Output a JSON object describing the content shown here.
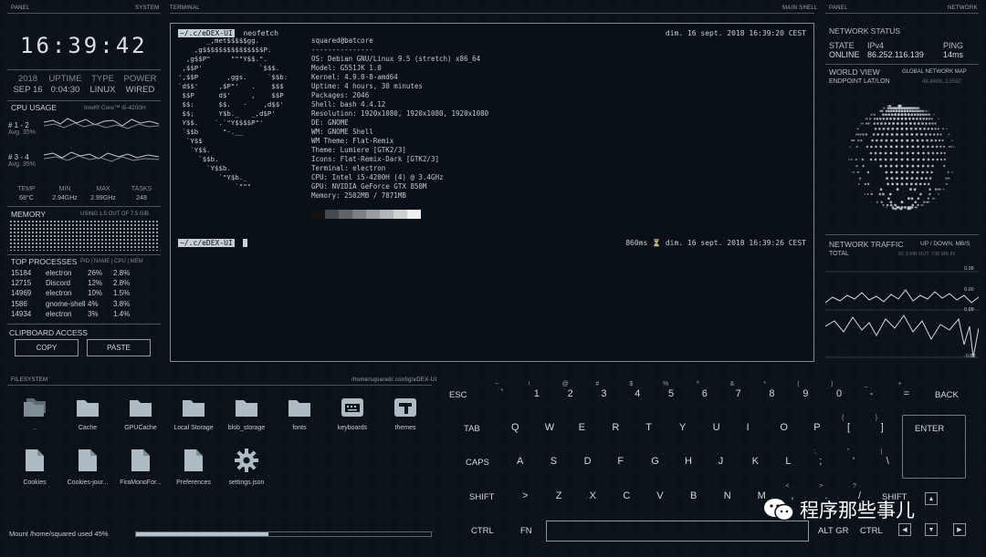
{
  "headers": {
    "panel_left": "PANEL",
    "system": "SYSTEM",
    "terminal": "TERMINAL",
    "main_shell": "MAIN SHELL",
    "panel_right": "PANEL",
    "network": "NETWORK",
    "filesystem": "FILESYSTEM",
    "fs_path": "/home/squared/.config/eDEX-UI"
  },
  "clock": "16:39:42",
  "system": {
    "labels": [
      "2018",
      "UPTIME",
      "TYPE",
      "POWER"
    ],
    "values": [
      "SEP 16",
      "0:04:30",
      "LINUX",
      "WIRED"
    ]
  },
  "cpu": {
    "title": "CPU USAGE",
    "model": "Intel® Core™ i5-4200H",
    "rows": [
      {
        "label": "# 1 - 2",
        "avg": "Avg. 35%"
      },
      {
        "label": "# 3 - 4",
        "avg": "Avg. 35%"
      }
    ],
    "stat_labels": [
      "TEMP",
      "MIN",
      "MAX",
      "TASKS"
    ],
    "stat_values": [
      "68°C",
      "2.94GHz",
      "2.99GHz",
      "248"
    ]
  },
  "memory": {
    "title": "MEMORY",
    "usage": "USING 1.5 OUT OF 7.5 GiB"
  },
  "processes": {
    "title": "TOP PROCESSES",
    "columns": "PID | NAME | CPU | MEM",
    "rows": [
      [
        "15184",
        "electron",
        "26%",
        "2.8%"
      ],
      [
        "12715",
        "Discord",
        "12%",
        "2.8%"
      ],
      [
        "14969",
        "electron",
        "10%",
        "1.5%"
      ],
      [
        "1586",
        "gnome-shell",
        "4%",
        "3.8%"
      ],
      [
        "14934",
        "electron",
        "3%",
        "1.4%"
      ]
    ]
  },
  "clipboard": {
    "title": "CLIPBOARD ACCESS",
    "copy": "COPY",
    "paste": "PASTE"
  },
  "terminal": {
    "prompt": "~/.c/eDEX-UI",
    "cmd": "neofetch",
    "date1": "dim. 16 sept. 2018 16:39:20 CEST",
    "ascii": "       _,met$$$$$gg.\n    ,g$$$$$$$$$$$$$$$P.\n  ,g$$P\"     \"\"\"Y$$.\".\n ,$$P'              `$$$.\n',$$P       ,ggs.     `$$b:\n`d$$'     ,$P\"'   .    $$$\n $$P      d$'     ,    $$P\n $$:      $$.   -    ,d$$'\n $$;      Y$b._   _,d$P'\n Y$$.    `.`\"Y$$$$P\"'\n `$$b      \"-.__\n  `Y$$\n   `Y$$.\n     `$$b.\n       `Y$$b.\n          `\"Y$b._\n              `\"\"\"",
    "info": "squared@batcore\n---------------\nOS: Debian GNU/Linux 9.5 (stretch) x86_64\nModel: G551JK 1.0\nKernel: 4.9.0-8-amd64\nUptime: 4 hours, 30 minutes\nPackages: 2046\nShell: bash 4.4.12\nResolution: 1920x1080, 1920x1080, 1920x1080\nDE: GNOME\nWM: GNOME Shell\nWM Theme: Flat-Remix\nTheme: Lumiere [GTK2/3]\nIcons: Flat-Remix-Dark [GTK2/3]\nTerminal: electron\nCPU: Intel i5-4200H (4) @ 3.4GHz\nGPU: NVIDIA GeForce GTX 850M\nMemory: 2502MB / 7871MB",
    "date2": "860ms ⏳ dim. 16 sept. 2018 16:39:26 CEST",
    "swatches": [
      "#111111",
      "#444a4e",
      "#5e6468",
      "#7a8084",
      "#969c9f",
      "#b1b6b8",
      "#cdd1d2",
      "#eef0f0"
    ]
  },
  "network": {
    "status_title": "NETWORK STATUS",
    "labels": [
      "STATE",
      "IPv4",
      "PING"
    ],
    "values": [
      "ONLINE",
      "86.252.116.139",
      "14ms"
    ],
    "world_title": "WORLD VIEW",
    "world_sub": "GLOBAL NETWORK MAP",
    "endpoint": "ENDPOINT LAT/LON",
    "endpoint_val": "48.8499, 2.5587",
    "traffic_title": "NETWORK TRAFFIC",
    "traffic_sub": "UP / DOWN, MB/S",
    "total": "TOTAL",
    "total_val": "82.3 MB OUT, 738 MB IN",
    "scale": [
      "0.38",
      "0.00",
      "0.88",
      "-0.88"
    ]
  },
  "files": [
    {
      "name": "..",
      "icon": "folder-up-icon"
    },
    {
      "name": "Cache",
      "icon": "folder-icon"
    },
    {
      "name": "GPUCache",
      "icon": "folder-icon"
    },
    {
      "name": "Local Storage",
      "icon": "folder-icon"
    },
    {
      "name": "blob_storage",
      "icon": "folder-icon"
    },
    {
      "name": "fonts",
      "icon": "folder-icon"
    },
    {
      "name": "keyboards",
      "icon": "keyboard-icon"
    },
    {
      "name": "themes",
      "icon": "theme-icon"
    },
    {
      "name": "Cookies",
      "icon": "file-icon"
    },
    {
      "name": "Cookies-jour...",
      "icon": "file-icon"
    },
    {
      "name": "FiraMonoFor...",
      "icon": "file-icon"
    },
    {
      "name": "Preferences",
      "icon": "file-icon"
    },
    {
      "name": "settings.json",
      "icon": "gear-icon"
    }
  ],
  "mount": {
    "prefix": "Mount ",
    "path": "/home/squared",
    "mid": " used ",
    "pct": "45%",
    "value": 45
  },
  "keyboard": {
    "esc": "ESC",
    "back": "BACK",
    "tab": "TAB",
    "enter": "ENTER",
    "caps": "CAPS",
    "shift": "SHIFT",
    "ctrl": "CTRL",
    "fn": "FN",
    "altgr": "ALT GR",
    "row1": [
      [
        "~",
        "`"
      ],
      [
        "!",
        "1"
      ],
      [
        "@",
        "2"
      ],
      [
        "#",
        "3"
      ],
      [
        "$",
        "4"
      ],
      [
        "%",
        "5"
      ],
      [
        "^",
        "6"
      ],
      [
        "&",
        "7"
      ],
      [
        "*",
        "8"
      ],
      [
        "(",
        "9"
      ],
      [
        ")",
        "0"
      ],
      [
        "_",
        "-"
      ],
      [
        "+",
        "="
      ]
    ],
    "row2": [
      "Q",
      "W",
      "E",
      "R",
      "T",
      "Y",
      "U",
      "I",
      "O",
      "P",
      [
        "{",
        "["
      ],
      [
        "}",
        "]"
      ]
    ],
    "row3": [
      "A",
      "S",
      "D",
      "F",
      "G",
      "H",
      "J",
      "K",
      "L",
      [
        ":",
        ";"
      ],
      [
        "\"",
        "'"
      ],
      [
        "|",
        "\\"
      ]
    ],
    "row4": [
      [
        "",
        ">"
      ],
      "Z",
      "X",
      "C",
      "V",
      "B",
      "N",
      "M",
      [
        "<",
        ","
      ],
      [
        ">",
        "."
      ],
      [
        "?",
        "/"
      ]
    ]
  },
  "watermark": "程序那些事儿"
}
